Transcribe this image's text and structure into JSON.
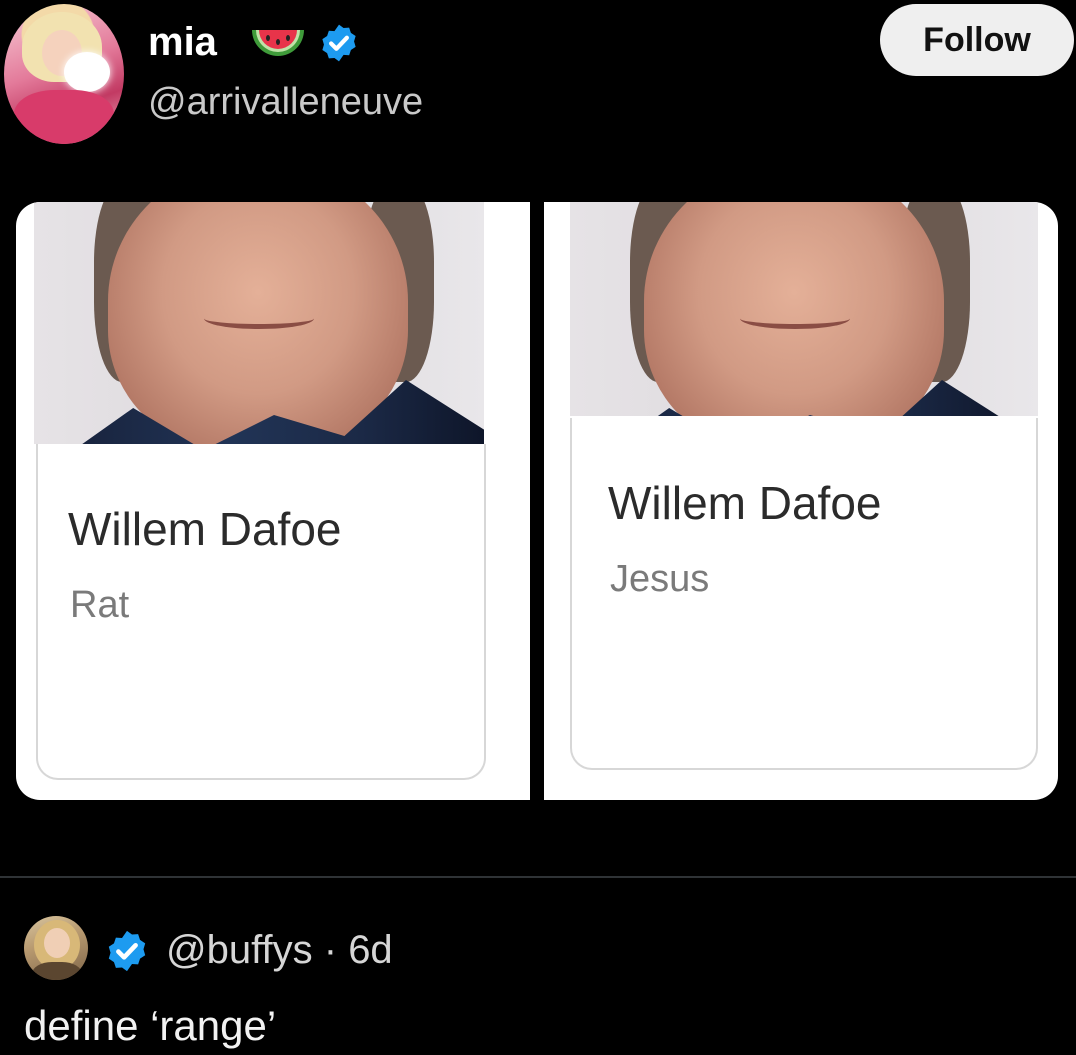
{
  "post": {
    "author": {
      "name": "mia",
      "handle": "@arrivalleneuve",
      "name_emoji": "watermelon-icon",
      "verified": true
    },
    "follow_label": "Follow",
    "image": {
      "panels": [
        {
          "name": "Willem Dafoe",
          "role": "Rat"
        },
        {
          "name": "Willem Dafoe",
          "role": "Jesus"
        }
      ]
    }
  },
  "reply": {
    "handle": "@buffys",
    "separator": "·",
    "age": "6d",
    "text": "define ‘range’",
    "verified": true
  },
  "colors": {
    "background": "#000000",
    "verified_blue": "#1d9bf0",
    "follow_bg": "#efefef"
  }
}
